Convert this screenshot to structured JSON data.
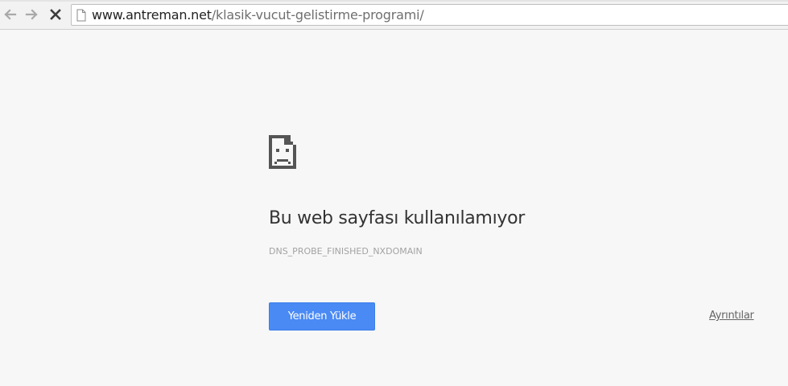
{
  "toolbar": {
    "back_icon": "arrow-left-icon",
    "forward_icon": "arrow-right-icon",
    "stop_icon": "close-icon",
    "url_host": "www.antreman.net",
    "url_path": "/klasik-vucut-gelistirme-programi/",
    "page_icon": "page-icon"
  },
  "error": {
    "icon": "sad-page-icon",
    "heading": "Bu web sayfası kullanılamıyor",
    "code": "DNS_PROBE_FINISHED_NXDOMAIN",
    "reload_label": "Yeniden Yükle",
    "details_label": "Ayrıntılar"
  },
  "colors": {
    "background": "#f7f7f7",
    "button": "#4a8af4",
    "heading": "#333333",
    "code": "#a3a3a3"
  }
}
